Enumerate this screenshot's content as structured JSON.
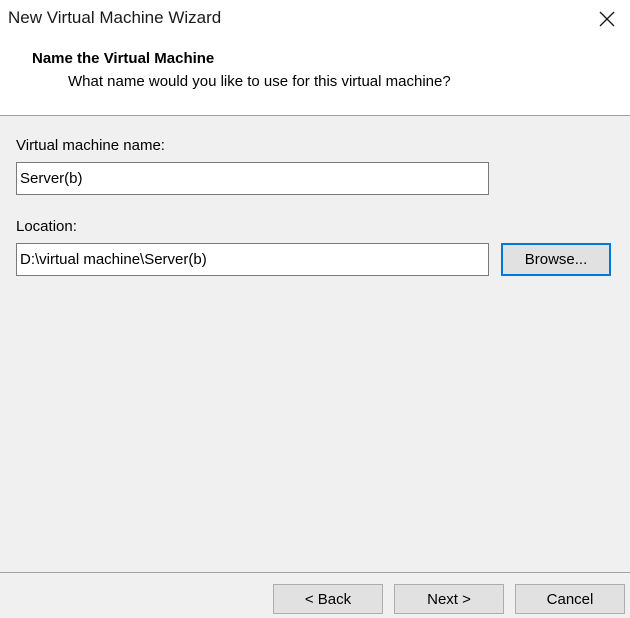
{
  "window": {
    "title": "New Virtual Machine Wizard",
    "close_icon": "close-x"
  },
  "header": {
    "title": "Name the Virtual Machine",
    "subtitle": "What name would you like to use for this virtual machine?"
  },
  "form": {
    "vm_name_label": "Virtual machine name:",
    "vm_name_value": "Server(b)",
    "location_label": "Location:",
    "location_value": "D:\\virtual machine\\Server(b)",
    "browse_label": "Browse..."
  },
  "footer": {
    "back_label": "< Back",
    "next_label": "Next >",
    "cancel_label": "Cancel"
  },
  "colors": {
    "focus_border": "#0078d7",
    "dialog_background": "#f0f0f0",
    "header_background": "#ffffff"
  }
}
